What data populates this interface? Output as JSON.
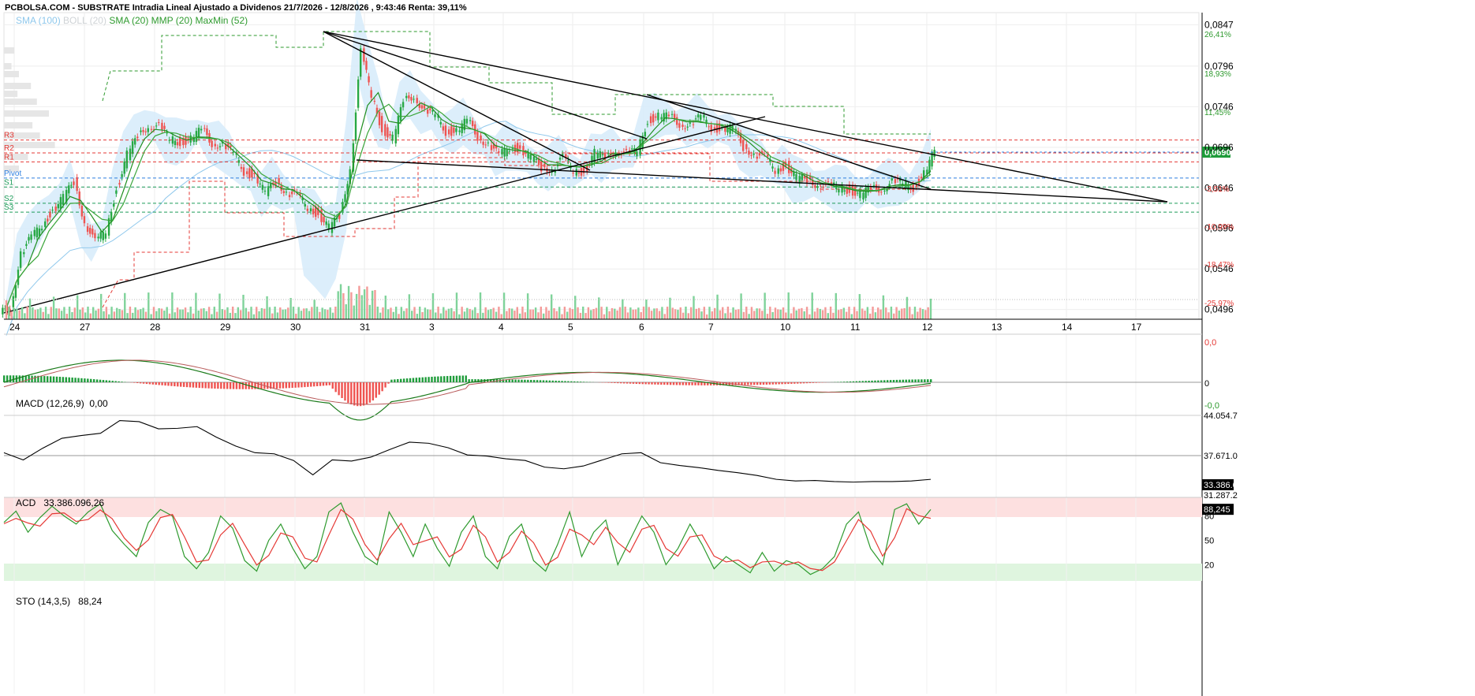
{
  "header": {
    "title": "PCBOLSA.COM - SUBSTRATE Intradia Lineal Ajustado a Dividenos 21/7/2026 - 12/8/2026 , 9:43:46 Renta: 39,11%"
  },
  "legend": {
    "items": [
      {
        "label": "SMA (100)",
        "color": "#8fc8ec"
      },
      {
        "label": "BOLL (20)",
        "color": "#cfd3d6"
      },
      {
        "label": "SMA (20)",
        "color": "#2e9a2e"
      },
      {
        "label": "MMP (20)",
        "color": "#2e9a2e"
      },
      {
        "label": "MaxMin (52)",
        "color": "#2e9a2e"
      }
    ]
  },
  "colors": {
    "up": "#27a844",
    "down": "#ef5350",
    "boll_fill": "#d6ebfa",
    "sma100": "#8fc8ec",
    "green_line": "#2e8b2e",
    "resistance": "#e53935",
    "support": "#1e9c5a",
    "pivot": "#2e7fe0"
  },
  "pivots": [
    {
      "label": "R3",
      "value": 0.0705,
      "color": "#e53935"
    },
    {
      "label": "R2",
      "value": 0.0689,
      "color": "#e53935"
    },
    {
      "label": "R1",
      "value": 0.0678,
      "color": "#e53935"
    },
    {
      "label": "Pivot",
      "value": 0.0658,
      "color": "#2e7fe0"
    },
    {
      "label": "S1",
      "value": 0.0647,
      "color": "#1e9c5a"
    },
    {
      "label": "S2",
      "value": 0.0627,
      "color": "#1e9c5a"
    },
    {
      "label": "S3",
      "value": 0.0616,
      "color": "#1e9c5a"
    }
  ],
  "chart_data": [
    {
      "type": "candlestick",
      "title": "SUBSTRATE Intradia",
      "x_ticks": [
        "24",
        "27",
        "28",
        "29",
        "30",
        "31",
        "3",
        "4",
        "5",
        "6",
        "7",
        "10",
        "11",
        "12",
        "13",
        "14",
        "17"
      ],
      "y_ticks": [
        "0,0847",
        "0,0796",
        "0,0746",
        "0,0696",
        "0,0646",
        "0,0596",
        "0,0546",
        "0,0496"
      ],
      "pct_ticks": [
        "26,41%",
        "18,93%",
        "11,45%",
        "-3,51%",
        "-10,99%",
        "-18,47%",
        "-25,97%"
      ],
      "ylim": [
        0.0484,
        0.0862
      ],
      "last_price": "0,0690",
      "close_series": [
        0.0498,
        0.0566,
        0.0584,
        0.0601,
        0.0619,
        0.0633,
        0.0654,
        0.0604,
        0.0578,
        0.0593,
        0.0646,
        0.0686,
        0.0709,
        0.0724,
        0.0721,
        0.0705,
        0.0703,
        0.0706,
        0.0717,
        0.0702,
        0.0699,
        0.0687,
        0.0667,
        0.0661,
        0.0638,
        0.0655,
        0.0641,
        0.0635,
        0.0622,
        0.0614,
        0.0596,
        0.0611,
        0.0672,
        0.0812,
        0.0759,
        0.0719,
        0.0706,
        0.0752,
        0.0761,
        0.0739,
        0.0735,
        0.0716,
        0.0716,
        0.0728,
        0.071,
        0.07,
        0.0685,
        0.0697,
        0.0694,
        0.0682,
        0.0671,
        0.067,
        0.0682,
        0.0667,
        0.0667,
        0.0688,
        0.0682,
        0.0694,
        0.0687,
        0.0691,
        0.073,
        0.0734,
        0.0733,
        0.0726,
        0.0723,
        0.0733,
        0.0721,
        0.0719,
        0.0718,
        0.0697,
        0.0688,
        0.0683,
        0.0668,
        0.0674,
        0.0657,
        0.0655,
        0.0651,
        0.0647,
        0.0646,
        0.0644,
        0.0637,
        0.0644,
        0.0646,
        0.0653,
        0.065,
        0.0647,
        0.0664,
        0.069
      ],
      "macd": {
        "title": "MACD (12,26,9)",
        "value": "0,00",
        "ticks": [
          "0,0",
          "0",
          "-0,0"
        ]
      },
      "acd": {
        "title": "ACD",
        "value": "33.386.096,26",
        "ticks": [
          "44.054.7",
          "37.671.0",
          "33.386.0",
          "31.287.2"
        ],
        "series": [
          38.2,
          36.9,
          39.0,
          40.8,
          41.3,
          41.7,
          44.0,
          43.8,
          42.5,
          42.6,
          42.9,
          41.0,
          39.4,
          38.2,
          38.0,
          36.8,
          34.2,
          36.9,
          36.7,
          37.4,
          38.8,
          40.1,
          39.9,
          39.1,
          37.8,
          37.6,
          37.1,
          36.8,
          35.6,
          35.3,
          35.8,
          36.9,
          38.0,
          38.2,
          36.4,
          35.9,
          35.5,
          35.0,
          34.6,
          34.1,
          33.4,
          33.1,
          33.2,
          33.0,
          32.9,
          33.0,
          33.0,
          33.1,
          33.4
        ]
      },
      "sto": {
        "title": "STO (14,3,5)",
        "value": "88,24",
        "last": "88,245",
        "ticks": [
          "80",
          "50",
          "20"
        ],
        "series": [
          72,
          86,
          60,
          78,
          92,
          80,
          70,
          85,
          95,
          62,
          45,
          30,
          72,
          88,
          80,
          30,
          15,
          35,
          80,
          65,
          25,
          12,
          50,
          70,
          40,
          15,
          30,
          85,
          96,
          60,
          30,
          20,
          85,
          60,
          30,
          70,
          40,
          18,
          60,
          80,
          30,
          15,
          55,
          70,
          25,
          12,
          45,
          85,
          30,
          60,
          75,
          20,
          50,
          80,
          60,
          20,
          40,
          70,
          45,
          15,
          30,
          20,
          10,
          35,
          12,
          25,
          20,
          8,
          15,
          30,
          70,
          85,
          40,
          20,
          88,
          95,
          70,
          88
        ]
      }
    }
  ]
}
